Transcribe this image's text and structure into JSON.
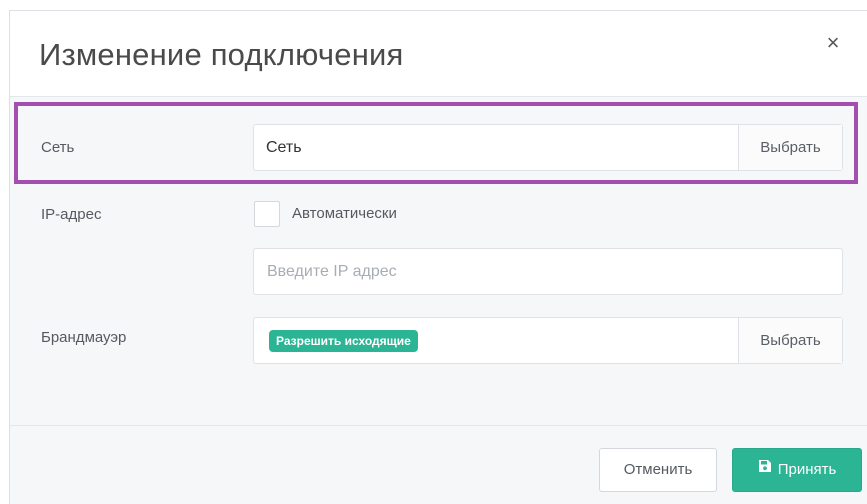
{
  "dialog": {
    "title": "Изменение подключения",
    "close_symbol": "×"
  },
  "network": {
    "label": "Сеть",
    "value": "Сеть",
    "select_label": "Выбрать"
  },
  "ip": {
    "label": "IP-адрес",
    "auto_checkbox_label": "Автоматически",
    "auto_checked": false,
    "placeholder": "Введите IP адрес"
  },
  "firewall": {
    "label": "Брандмауэр",
    "tag": "Разрешить исходящие",
    "select_label": "Выбрать"
  },
  "footer": {
    "cancel_label": "Отменить",
    "accept_label": "Принять",
    "accept_icon": "floppy-disk-icon"
  },
  "colors": {
    "accent": "#2bb594",
    "highlight_border": "#a24fb0"
  }
}
